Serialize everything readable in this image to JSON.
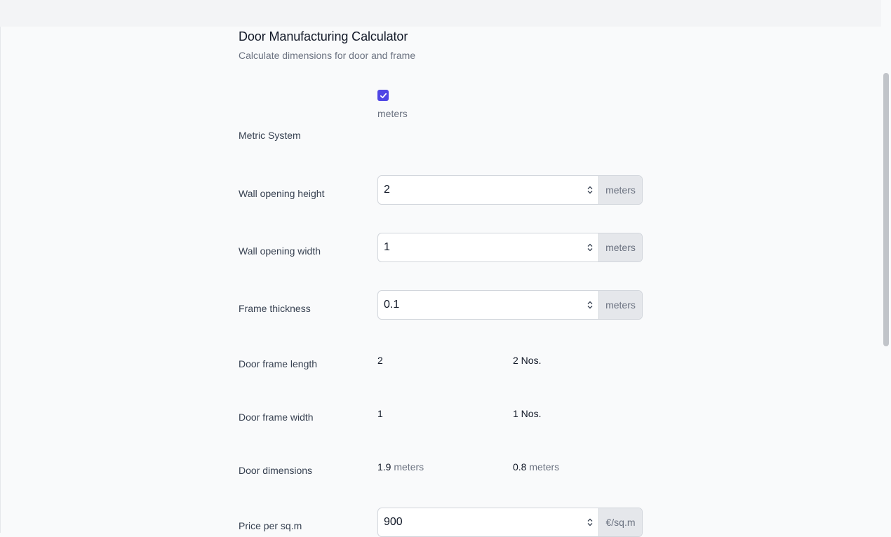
{
  "header": {
    "title": "Door Manufacturing Calculator",
    "subtitle": "Calculate dimensions for door and frame"
  },
  "metric": {
    "label": "Metric System",
    "checked": true,
    "unit_text": "meters"
  },
  "fields": {
    "height": {
      "label": "Wall opening height",
      "value": "2",
      "unit": "meters"
    },
    "width": {
      "label": "Wall opening width",
      "value": "1",
      "unit": "meters"
    },
    "thickness": {
      "label": "Frame thickness",
      "value": "0.1",
      "unit": "meters"
    },
    "price": {
      "label": "Price per sq.m",
      "value": "900",
      "unit": "€/sq.m"
    }
  },
  "results": {
    "frame_length": {
      "label": "Door frame length",
      "value": "2",
      "count": "2 Nos."
    },
    "frame_width": {
      "label": "Door frame width",
      "value": "1",
      "count": "1 Nos."
    },
    "door_dimensions": {
      "label": "Door dimensions",
      "height": "1.9",
      "height_unit": "meters",
      "width": "0.8",
      "width_unit": "meters"
    }
  },
  "colors": {
    "accent": "#4f46e5",
    "addon_bg": "#e5e7eb",
    "muted_text": "#6b7280"
  },
  "icons": {
    "checkbox": "checkmark-icon",
    "spinner": "spinner-arrows-icon"
  }
}
